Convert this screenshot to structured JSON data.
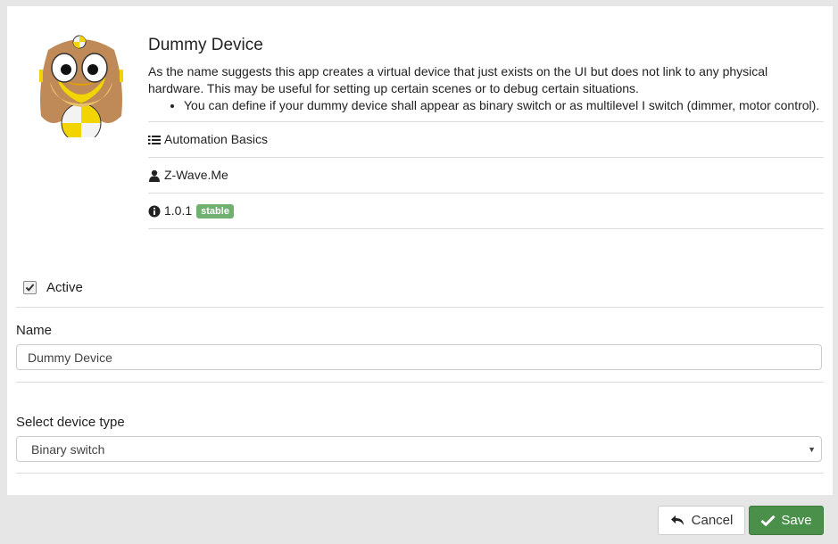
{
  "app": {
    "title": "Dummy Device",
    "description": "As the name suggests this app creates a virtual device that just exists on the UI but does not link to any physical hardware. This may be useful for setting up certain scenes or to debug certain situations.",
    "bullets": [
      "You can define if your dummy device shall appear as binary switch or as multilevel I switch (dimmer, motor control)."
    ],
    "category": "Automation Basics",
    "author": "Z-Wave.Me",
    "version": "1.0.1",
    "maturity": "stable",
    "icons": {
      "category": "list-icon",
      "author": "user-icon",
      "version": "info-icon"
    }
  },
  "form": {
    "active_label": "Active",
    "active_checked": true,
    "name_label": "Name",
    "name_value": "Dummy Device",
    "device_type_label": "Select device type",
    "device_type_value": "Binary switch"
  },
  "footer": {
    "cancel_label": "Cancel",
    "save_label": "Save"
  },
  "colors": {
    "save": "#4a8f4a",
    "badge": "#70b070"
  }
}
